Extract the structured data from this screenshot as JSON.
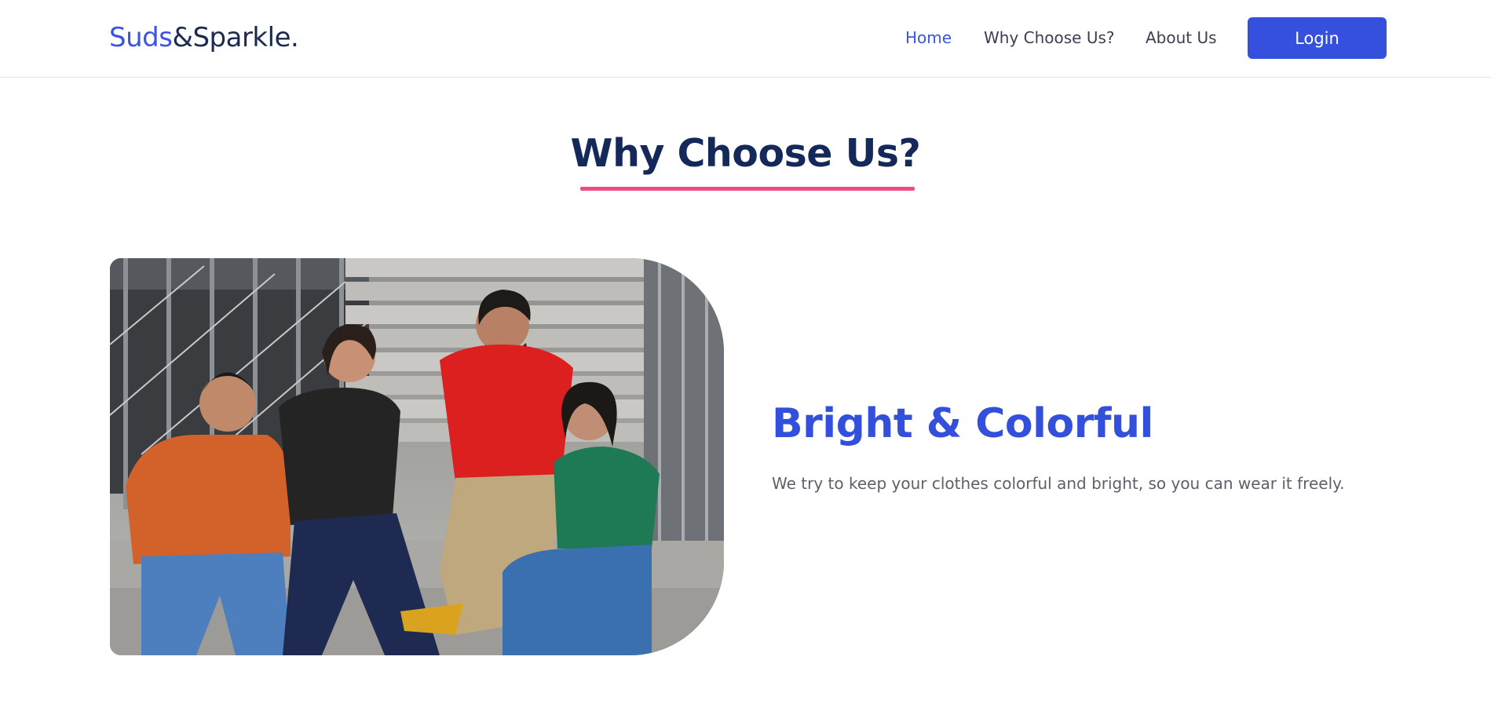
{
  "brand": {
    "name_part1": "Suds",
    "name_part2": "&Sparkle.",
    "accent_color": "#3a55e0",
    "text_color": "#1b2a4e"
  },
  "nav": {
    "links": [
      {
        "label": "Home",
        "active": true
      },
      {
        "label": "Why Choose Us?",
        "active": false
      },
      {
        "label": "About Us",
        "active": false
      }
    ],
    "login_label": "Login"
  },
  "section": {
    "title": "Why Choose Us?",
    "underline_color": "#ee4d84"
  },
  "feature": {
    "title": "Bright & Colorful",
    "description": "We try to keep your clothes colorful and bright, so you can wear it freely."
  },
  "colors": {
    "primary": "#3550dc",
    "heading": "#15285a",
    "body_text": "#5d5f6b"
  }
}
